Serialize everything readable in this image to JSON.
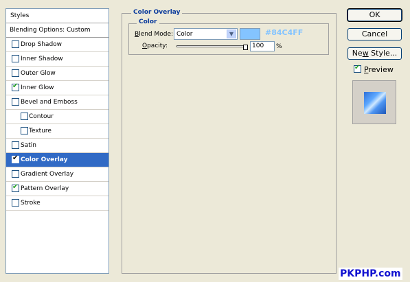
{
  "styles_panel": {
    "header": "Styles",
    "blending_options": "Blending Options: Custom",
    "items": [
      {
        "label": "Drop Shadow",
        "checked": false,
        "sub": false,
        "selected": false
      },
      {
        "label": "Inner Shadow",
        "checked": false,
        "sub": false,
        "selected": false
      },
      {
        "label": "Outer Glow",
        "checked": false,
        "sub": false,
        "selected": false
      },
      {
        "label": "Inner Glow",
        "checked": true,
        "sub": false,
        "selected": false
      },
      {
        "label": "Bevel and Emboss",
        "checked": false,
        "sub": false,
        "selected": false
      },
      {
        "label": "Contour",
        "checked": false,
        "sub": true,
        "selected": false
      },
      {
        "label": "Texture",
        "checked": false,
        "sub": true,
        "selected": false
      },
      {
        "label": "Satin",
        "checked": false,
        "sub": false,
        "selected": false
      },
      {
        "label": "Color Overlay",
        "checked": true,
        "sub": false,
        "selected": true
      },
      {
        "label": "Gradient Overlay",
        "checked": false,
        "sub": false,
        "selected": false
      },
      {
        "label": "Pattern Overlay",
        "checked": true,
        "sub": false,
        "selected": false
      },
      {
        "label": "Stroke",
        "checked": false,
        "sub": false,
        "selected": false
      }
    ]
  },
  "color_overlay": {
    "group_title": "Color Overlay",
    "sub_group_title": "Color",
    "blend_mode_label": "Blend Mode:",
    "blend_mode_value": "Color",
    "color_hex": "#84C4FF",
    "color_label": "#84C4FF",
    "opacity_label": "Opacity:",
    "opacity_value": "100",
    "opacity_fraction": 1.0,
    "opacity_unit": "%"
  },
  "buttons": {
    "ok": "OK",
    "cancel": "Cancel",
    "new_style": "New Style..."
  },
  "preview": {
    "label": "Preview",
    "checked": true
  },
  "watermark": "PKPHP.com",
  "colors": {
    "selection": "#316AC5",
    "heading": "#0A3A9C",
    "check": "#21A121"
  }
}
